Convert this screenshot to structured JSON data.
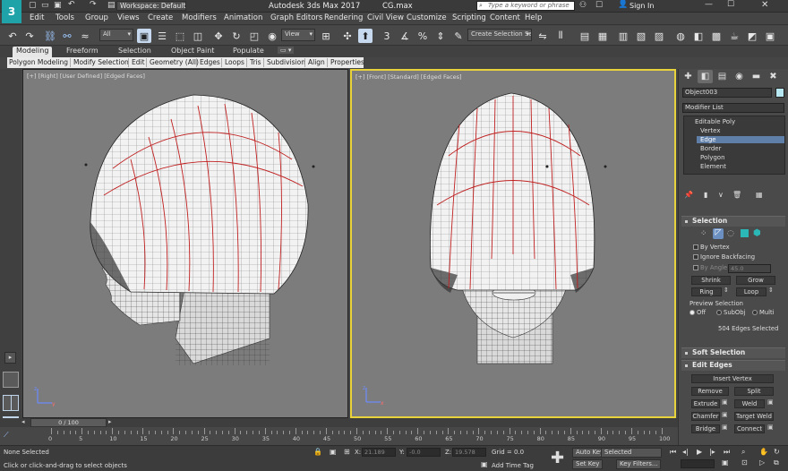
{
  "titlebar": {
    "workspace": "Workspace: Default",
    "app_title": "Autodesk 3ds Max 2017",
    "file": "CG.max",
    "search_placeholder": "Type a keyword or phrase",
    "sign_in": "Sign In"
  },
  "menu": [
    "Edit",
    "Tools",
    "Group",
    "Views",
    "Create",
    "Modifiers",
    "Animation",
    "Graph Editors",
    "Rendering",
    "Civil View",
    "Customize",
    "Scripting",
    "Content",
    "Help"
  ],
  "toolbar": {
    "filter": "All",
    "coord": "View",
    "selection_set": "Create Selection Se"
  },
  "ribbon_tabs": [
    "Modeling",
    "Freeform",
    "Selection",
    "Object Paint",
    "Populate"
  ],
  "ribbon_items": [
    "Polygon Modeling",
    "Modify Selection",
    "Edit",
    "Geometry (All)",
    "Edges",
    "Loops",
    "Tris",
    "Subdivision",
    "Align",
    "Properties"
  ],
  "viewports": {
    "right_label": "[+] [Right] [User Defined] [Edged Faces]",
    "front_label": "[+] [Front] [Standard] [Edged Faces]"
  },
  "command_panel": {
    "object_name": "Object003",
    "modifier_list": "Modifier List",
    "stack": [
      "Editable Poly",
      "Vertex",
      "Edge",
      "Border",
      "Polygon",
      "Element"
    ],
    "selection": {
      "title": "Selection",
      "by_vertex": "By Vertex",
      "ignore_backfacing": "Ignore Backfacing",
      "by_angle": "By Angle:",
      "angle_value": "45.0",
      "shrink": "Shrink",
      "grow": "Grow",
      "ring": "Ring",
      "loop": "Loop",
      "preview": "Preview Selection",
      "off": "Off",
      "subobj": "SubObj",
      "multi": "Multi",
      "status": "504 Edges Selected"
    },
    "soft_selection": "Soft Selection",
    "edit_edges": {
      "title": "Edit Edges",
      "insert_vertex": "Insert Vertex",
      "remove": "Remove",
      "split": "Split",
      "extrude": "Extrude",
      "weld": "Weld",
      "chamfer": "Chamfer",
      "target_weld": "Target Weld",
      "bridge": "Bridge",
      "connect": "Connect"
    }
  },
  "timeline": {
    "frame": "0 / 100",
    "ticks": [
      "0",
      "5",
      "10",
      "15",
      "20",
      "25",
      "30",
      "35",
      "40",
      "45",
      "50",
      "55",
      "60",
      "65",
      "70",
      "75",
      "80",
      "85",
      "90",
      "95",
      "100"
    ]
  },
  "status": {
    "selected": "None Selected",
    "prompt": "Click or click-and-drag to select objects",
    "x_label": "X:",
    "x_value": "21.189",
    "y_label": "Y:",
    "y_value": "-0.0",
    "z_label": "Z:",
    "z_value": "19.578",
    "grid": "Grid = 0.0",
    "add_time_tag": "Add Time Tag",
    "auto_key": "Auto Key",
    "set_key": "Set Key",
    "selected_dd": "Selected",
    "key_filters": "Key Filters..."
  }
}
